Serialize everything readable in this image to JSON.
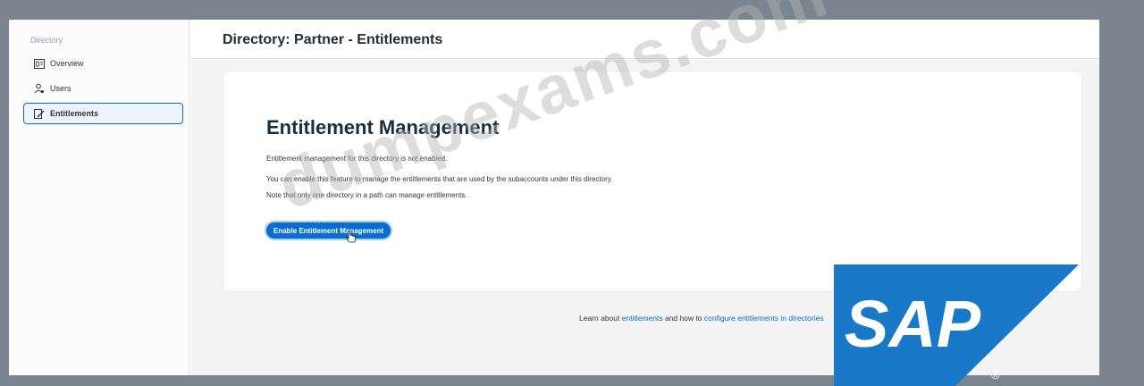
{
  "sidebar": {
    "heading": "Directory",
    "items": [
      {
        "label": "Overview",
        "icon": "overview-icon"
      },
      {
        "label": "Users",
        "icon": "users-icon"
      },
      {
        "label": "Entitlements",
        "icon": "entitlements-icon",
        "active": true
      }
    ]
  },
  "header": {
    "title": "Directory: Partner - Entitlements"
  },
  "card": {
    "title": "Entitlement Management",
    "line1": "Entitlement management for this directory is not enabled.",
    "line2": "You can enable this feature to manage the entitlements that are used by the subaccounts under this directory.",
    "line3": "Note that only one directory in a path can manage entitlements.",
    "button_label": "Enable Entitlement Management",
    "learn": {
      "prefix": "Learn about ",
      "link1": "entitlements",
      "middle": " and how to ",
      "link2": "configure entitlements in directories"
    }
  },
  "watermark": "dumpexams.com",
  "logo": {
    "text": "SAP",
    "mark": "®"
  },
  "colors": {
    "accent": "#0a6ed1",
    "logo_blue": "#1979c8",
    "background": "#7b8590"
  }
}
